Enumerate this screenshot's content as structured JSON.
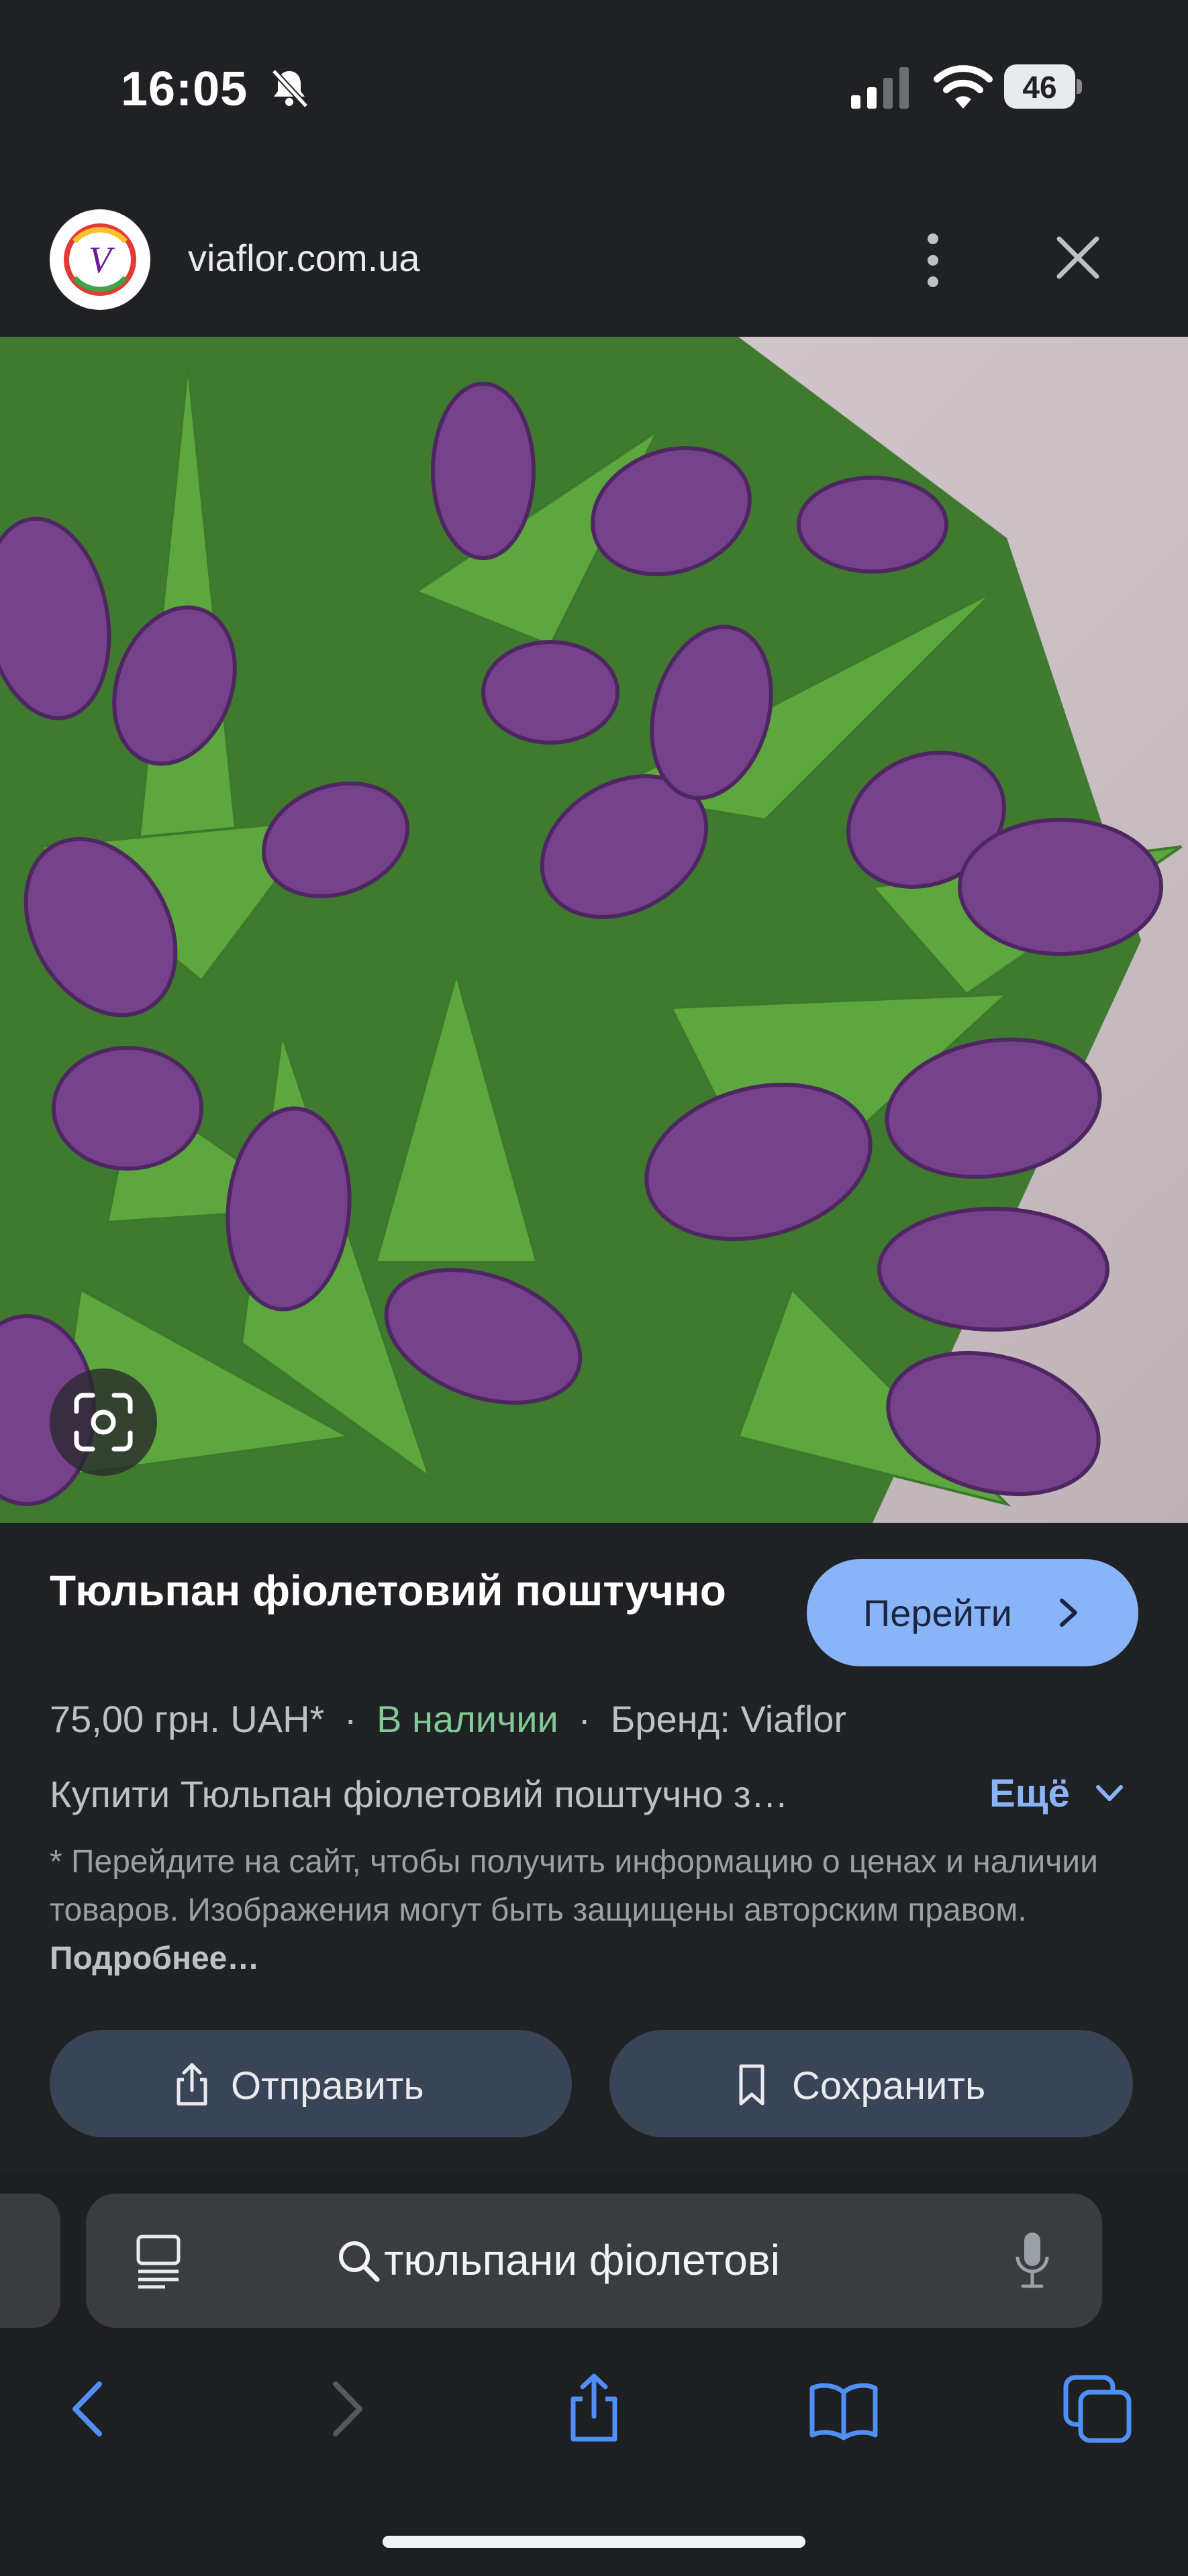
{
  "status_bar": {
    "time": "16:05",
    "battery": "46",
    "icons": [
      "bell-slash-icon",
      "cellular-signal-icon",
      "wifi-icon",
      "battery-icon"
    ]
  },
  "header": {
    "site_domain": "viaflor.com.ua",
    "favicon_letter": "V",
    "icons": [
      "more-vertical-icon",
      "close-icon"
    ]
  },
  "image": {
    "subject": "purple-tulips",
    "lens_icon": "lens-icon"
  },
  "product": {
    "title": "Тюльпан фіолетовий поштучно",
    "price": "75,00 грн. UAH*",
    "separator": "·",
    "availability": "В наличии",
    "brand": "Бренд: Viaflor",
    "description": "Купити Тюльпан фіолетовий поштучно з…",
    "more_label": "Ещё",
    "disclaimer": "* Перейдите на сайт, чтобы получить информацию о ценах и наличии товаров. Изображения могут быть защищены авторским правом.",
    "disclaimer_link": "Подробнее…"
  },
  "buttons": {
    "visit": "Перейти",
    "share": "Отправить",
    "save": "Сохранить"
  },
  "browser": {
    "query": "тюльпани фіолетові",
    "toolbar_icons": [
      "back-icon",
      "forward-icon",
      "share-icon",
      "bookmarks-icon",
      "tabs-icon"
    ]
  },
  "colors": {
    "background": "#202124",
    "accent": "#8ab4f8",
    "in_stock": "#81c995",
    "pill": "#394457"
  }
}
